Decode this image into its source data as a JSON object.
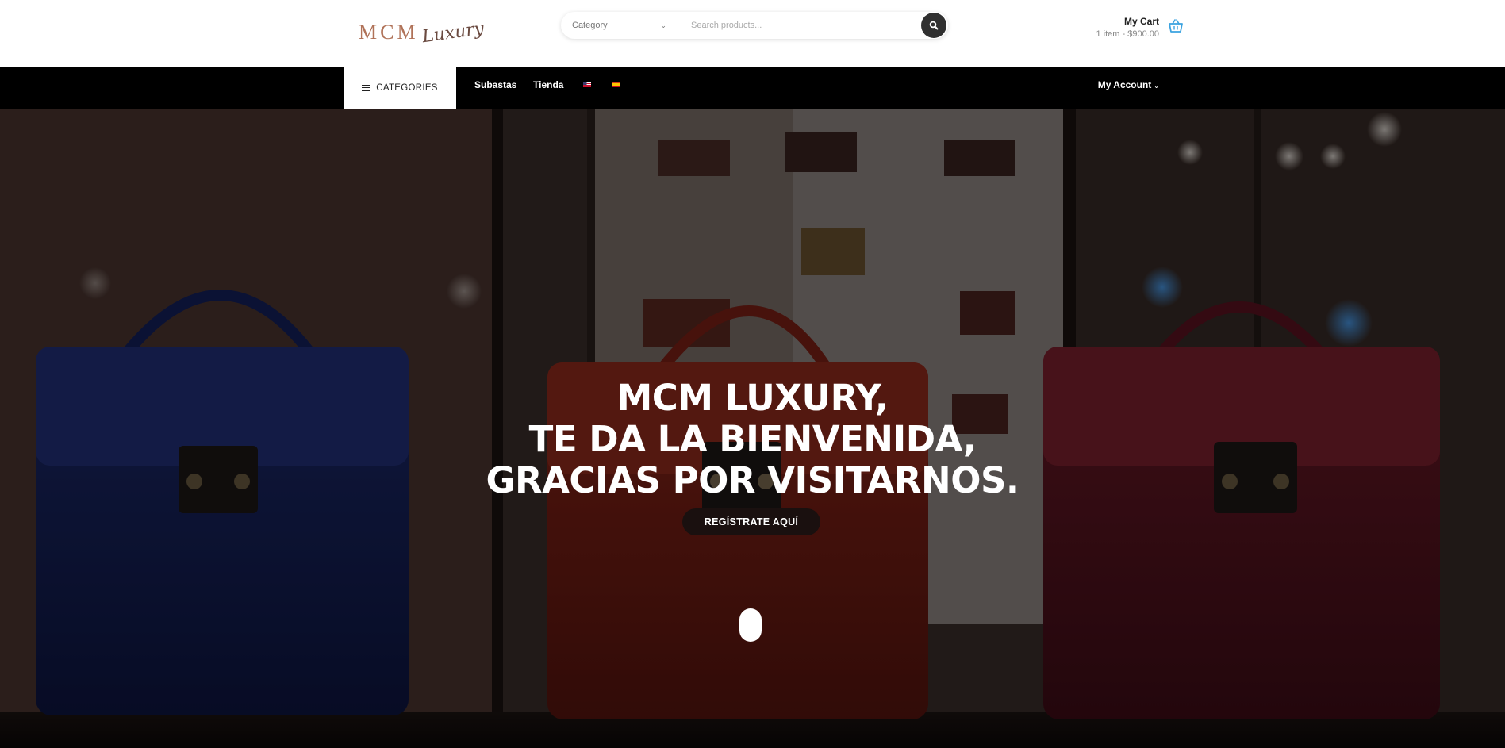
{
  "header": {
    "logo": {
      "mark": "MCM",
      "script": "Luxury"
    },
    "search": {
      "category_label": "Category",
      "placeholder": "Search products..."
    },
    "cart": {
      "title": "My Cart",
      "summary": "1 item - $900.00"
    }
  },
  "nav": {
    "categories_label": "CATEGORIES",
    "links": [
      {
        "label": "Subastas"
      },
      {
        "label": "Tienda"
      }
    ],
    "flags": [
      "us-flag-icon",
      "es-flag-icon"
    ],
    "account_label": "My Account"
  },
  "hero": {
    "title_lines": [
      "MCM LUXURY,",
      "TE DA LA BIENVENIDA,",
      "GRACIAS POR VISITARNOS."
    ],
    "cta_label": "REGÍSTRATE AQUÍ"
  },
  "colors": {
    "logo_mark": "#b07258",
    "nav_bg": "#000000",
    "cart_icon": "#3ba3e0",
    "cta_bg": "#1a100f"
  }
}
